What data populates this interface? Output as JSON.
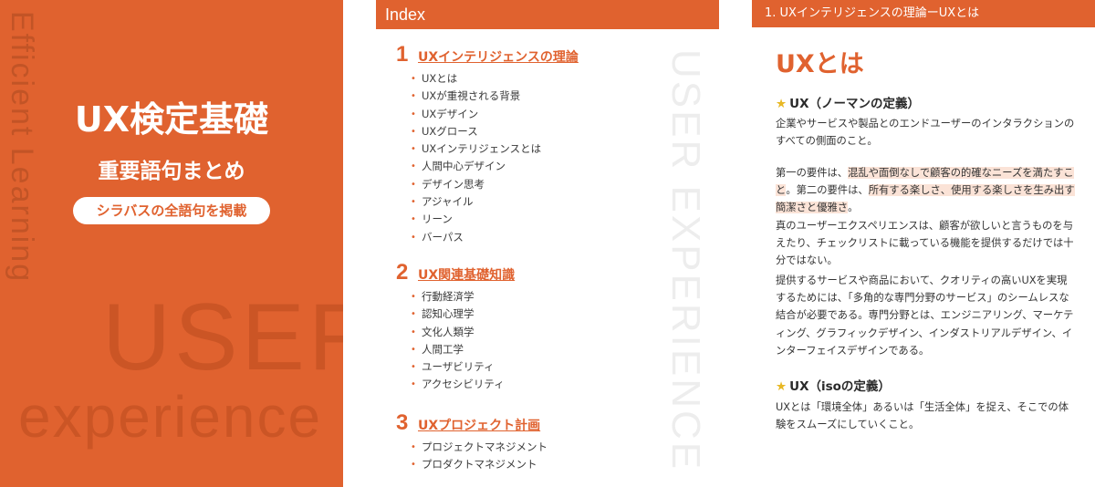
{
  "cover": {
    "vertical_text": "Efficient Learning",
    "watermark_user": "USER",
    "watermark_experience": "experience",
    "title": "UX検定基礎",
    "subtitle": "重要語句まとめ",
    "badge": "シラバスの全語句を掲載"
  },
  "index": {
    "header": "Index",
    "watermark": "USER EXPERIENCE",
    "sections": [
      {
        "number": "1",
        "title": "UXインテリジェンスの理論",
        "items": [
          "UXとは",
          "UXが重視される背景",
          "UXデザイン",
          "UXグロース",
          "UXインテリジェンスとは",
          "人間中心デザイン",
          "デザイン思考",
          "アジャイル",
          "リーン",
          "バーパス"
        ]
      },
      {
        "number": "2",
        "title": "UX関連基礎知識",
        "items": [
          "行動経済学",
          "認知心理学",
          "文化人類学",
          "人間工学",
          "ユーザビリティ",
          "アクセシビリティ"
        ]
      },
      {
        "number": "3",
        "title": "UXプロジェクト計画",
        "items": [
          "プロジェクトマネジメント",
          "プロダクトマネジメント"
        ]
      }
    ]
  },
  "content": {
    "header": "1. UXインテリジェンスの理論ーUXとは",
    "title": "UXとは",
    "section1": {
      "star": "★",
      "heading": "UX（ノーマンの定義）",
      "para1": "企業やサービスや製品とのエンドユーザーのインタラクションのすべての側面のこと。",
      "para2_a": "第一の要件は、",
      "para2_hl1": "混乱や面倒なしで顧客の的確なニーズを満たすこと",
      "para2_b": "。第二の要件は、",
      "para2_hl2": "所有する楽しさ、使用する楽しさを生み出す簡潔さと優雅さ",
      "para2_c": "。",
      "para2_d": "真のユーザーエクスペリエンスは、顧客が欲しいと言うものを与えたり、チェックリストに載っている機能を提供するだけでは十分ではない。",
      "para3": "提供するサービスや商品において、クオリティの高いUXを実現するためには、「多角的な専門分野のサービス」のシームレスな結合が必要である。専門分野とは、エンジニアリング、マーケティング、グラフィックデザイン、インダストリアルデザイン、インターフェイスデザインである。"
    },
    "section2": {
      "star": "★",
      "heading": "UX（isoの定義）",
      "para1": "UXとは「環境全体」あるいは「生活全体」を捉え、そこでの体験をスムーズにしていくこと。"
    }
  },
  "colors": {
    "accent": "#e0622f",
    "highlight": "#fbe3d7",
    "star": "#e8b825"
  }
}
